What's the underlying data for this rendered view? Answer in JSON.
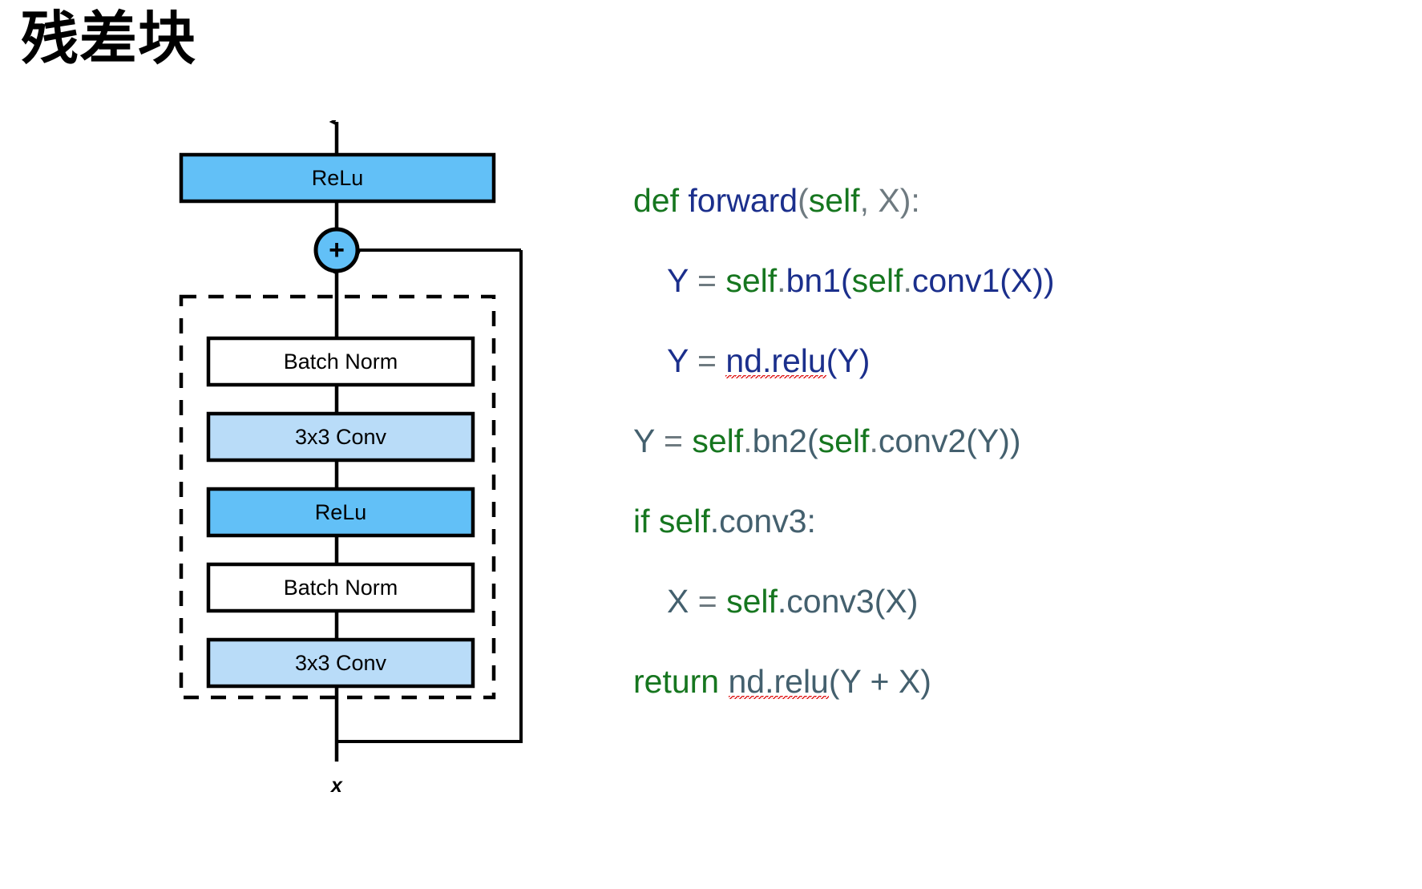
{
  "slide": {
    "title": "残差块"
  },
  "diagram": {
    "name": "residual-block-diagram",
    "input_label": "x",
    "add_node_label": "+",
    "colors": {
      "relu_fill": "#62c0f7",
      "conv_fill": "#b9dcf8",
      "batchnorm_fill": "#ffffff",
      "stroke": "#000000",
      "add_fill": "#62c0f7"
    },
    "blocks": [
      {
        "id": "relu-out",
        "label": "ReLu",
        "fill": "#62c0f7"
      },
      {
        "id": "bn-2",
        "label": "Batch Norm",
        "fill": "#ffffff"
      },
      {
        "id": "conv-2",
        "label": "3x3 Conv",
        "fill": "#b9dcf8"
      },
      {
        "id": "relu-mid",
        "label": "ReLu",
        "fill": "#62c0f7"
      },
      {
        "id": "bn-1",
        "label": "Batch Norm",
        "fill": "#ffffff"
      },
      {
        "id": "conv-1",
        "label": "3x3 Conv",
        "fill": "#b9dcf8"
      }
    ]
  },
  "code": {
    "name": "forward-method-code",
    "lines": [
      {
        "indent": 0,
        "tokens": [
          {
            "t": "def ",
            "c": "kw"
          },
          {
            "t": "forward",
            "c": "fn"
          },
          {
            "t": "(",
            "c": "punct"
          },
          {
            "t": "self",
            "c": "self"
          },
          {
            "t": ", ",
            "c": "punct"
          },
          {
            "t": "X",
            "c": "punct"
          },
          {
            "t": "):",
            "c": "punct"
          }
        ]
      },
      {
        "indent": 1,
        "tokens": [
          {
            "t": "Y",
            "c": "var"
          },
          {
            "t": " = ",
            "c": "op"
          },
          {
            "t": "self",
            "c": "self"
          },
          {
            "t": ".",
            "c": "punct"
          },
          {
            "t": "bn1",
            "c": "attr"
          },
          {
            "t": "(",
            "c": "attr"
          },
          {
            "t": "self",
            "c": "self"
          },
          {
            "t": ".",
            "c": "punct"
          },
          {
            "t": "conv1",
            "c": "attr"
          },
          {
            "t": "(X))",
            "c": "attr"
          }
        ]
      },
      {
        "indent": 1,
        "tokens": [
          {
            "t": "Y",
            "c": "var"
          },
          {
            "t": " = ",
            "c": "op"
          },
          {
            "t": "nd.relu",
            "c": "var",
            "misspell": true
          },
          {
            "t": "(Y)",
            "c": "var"
          }
        ]
      },
      {
        "indent": 0,
        "tokens": [
          {
            "t": "Y",
            "c": "slate"
          },
          {
            "t": " = ",
            "c": "op"
          },
          {
            "t": "self",
            "c": "self"
          },
          {
            "t": ".",
            "c": "punct"
          },
          {
            "t": "bn2",
            "c": "slate"
          },
          {
            "t": "(",
            "c": "slate"
          },
          {
            "t": "self",
            "c": "self"
          },
          {
            "t": ".",
            "c": "punct"
          },
          {
            "t": "conv2",
            "c": "slate"
          },
          {
            "t": "(Y))",
            "c": "slate"
          }
        ]
      },
      {
        "indent": 0,
        "tokens": [
          {
            "t": "if ",
            "c": "kw"
          },
          {
            "t": "self",
            "c": "self"
          },
          {
            "t": ".conv3:",
            "c": "slate"
          }
        ]
      },
      {
        "indent": 1,
        "tokens": [
          {
            "t": "X",
            "c": "slate"
          },
          {
            "t": " = ",
            "c": "op"
          },
          {
            "t": "self",
            "c": "self"
          },
          {
            "t": ".conv3(X)",
            "c": "slate"
          }
        ]
      },
      {
        "indent": 0,
        "tokens": [
          {
            "t": "return ",
            "c": "kw"
          },
          {
            "t": "nd.relu",
            "c": "slate",
            "misspell": true
          },
          {
            "t": "(Y + X)",
            "c": "slate"
          }
        ]
      }
    ]
  }
}
